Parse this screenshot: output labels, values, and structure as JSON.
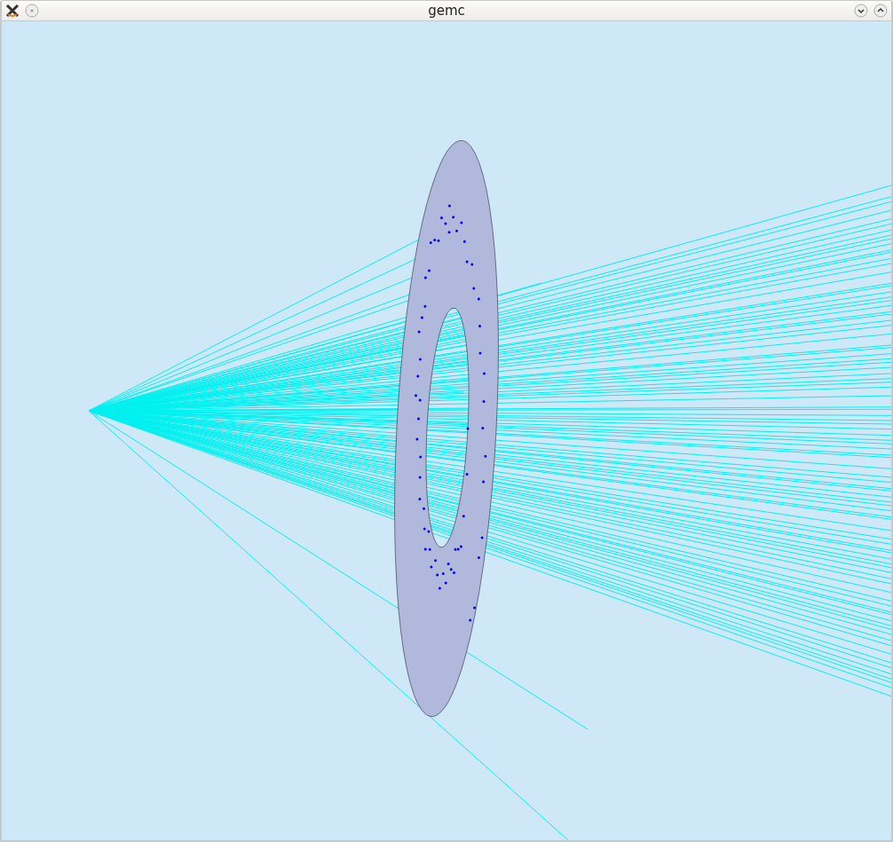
{
  "window": {
    "title": "gemc"
  }
}
